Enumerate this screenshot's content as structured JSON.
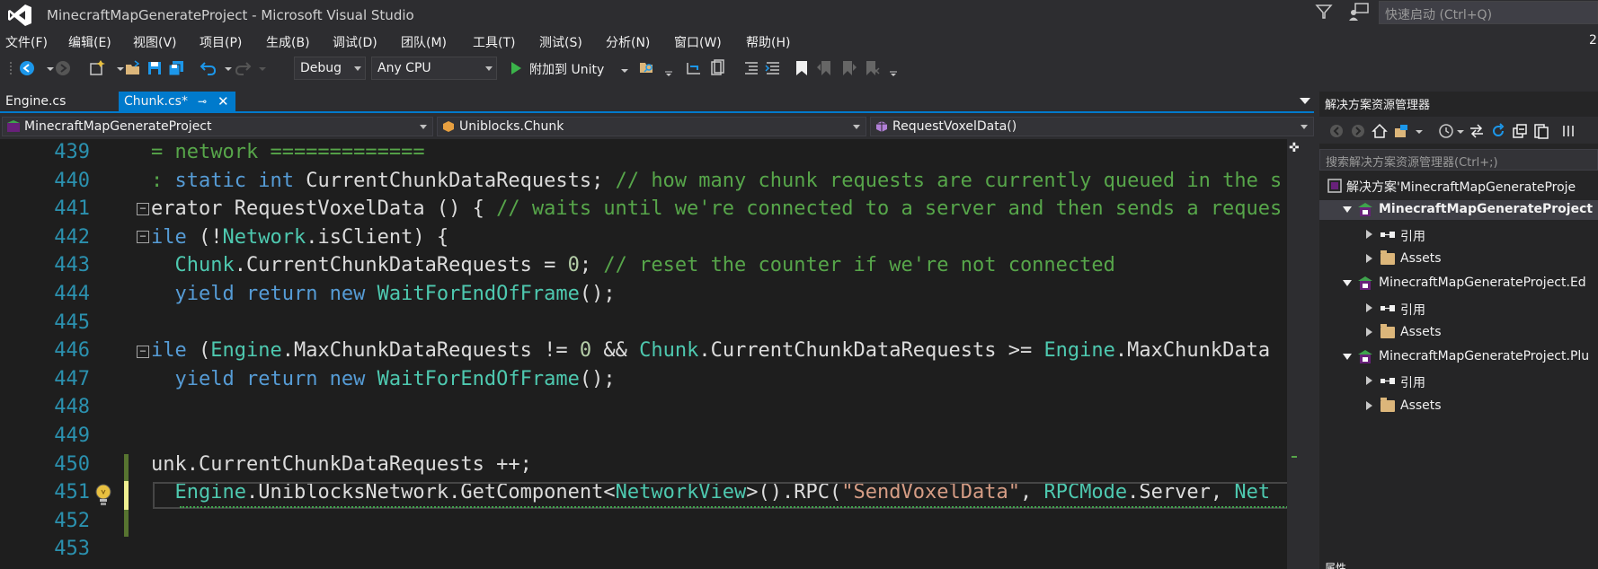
{
  "window": {
    "title": "MinecraftMapGenerateProject - Microsoft Visual Studio",
    "quick_launch_placeholder": "快速启动 (Ctrl+Q)",
    "right_edge_text": "2"
  },
  "menu": [
    "文件(F)",
    "编辑(E)",
    "视图(V)",
    "项目(P)",
    "生成(B)",
    "调试(D)",
    "团队(M)",
    "工具(T)",
    "测试(S)",
    "分析(N)",
    "窗口(W)",
    "帮助(H)"
  ],
  "toolbar": {
    "configuration": "Debug",
    "platform": "Any CPU",
    "start_label": "附加到 Unity"
  },
  "tabs": [
    {
      "label": "Engine.cs",
      "active": false
    },
    {
      "label": "Chunk.cs*",
      "active": true
    }
  ],
  "navbar": {
    "project": "MinecraftMapGenerateProject",
    "type": "Uniblocks.Chunk",
    "member": "RequestVoxelData()"
  },
  "editor": {
    "line_numbers": [
      "439",
      "440",
      "441",
      "442",
      "443",
      "444",
      "445",
      "446",
      "447",
      "448",
      "449",
      "450",
      "451",
      "452",
      "453"
    ],
    "code_lines": [
      [
        [
          "cm",
          "= network ============="
        ]
      ],
      [
        [
          "cm",
          ": "
        ],
        [
          "kw",
          "static int "
        ],
        [
          "",
          "CurrentChunkDataRequests; "
        ],
        [
          "cm",
          "// how many chunk requests are currently queued in the s"
        ]
      ],
      [
        [
          "",
          "erator RequestVoxelData () { "
        ],
        [
          "cm",
          "// waits until we're connected to a server and then sends a reques"
        ]
      ],
      [
        [
          "kw",
          "ile "
        ],
        [
          "",
          "(!"
        ],
        [
          "ty",
          "Network"
        ],
        [
          "",
          ".isClient) {"
        ]
      ],
      [
        [
          "",
          "  "
        ],
        [
          "ty",
          "Chunk"
        ],
        [
          "",
          ".CurrentChunkDataRequests = "
        ],
        [
          "nm",
          "0"
        ],
        [
          "",
          "; "
        ],
        [
          "cm",
          "// reset the counter if we're not connected"
        ]
      ],
      [
        [
          "",
          "  "
        ],
        [
          "kw",
          "yield return new "
        ],
        [
          "ty",
          "WaitForEndOfFrame"
        ],
        [
          "",
          "();"
        ]
      ],
      [
        [
          "",
          ""
        ]
      ],
      [
        [
          "kw",
          "ile "
        ],
        [
          "",
          "("
        ],
        [
          "ty",
          "Engine"
        ],
        [
          "",
          ".MaxChunkDataRequests != "
        ],
        [
          "nm",
          "0"
        ],
        [
          "",
          " && "
        ],
        [
          "ty",
          "Chunk"
        ],
        [
          "",
          ".CurrentChunkDataRequests >= "
        ],
        [
          "ty",
          "Engine"
        ],
        [
          "",
          ".MaxChunkData"
        ]
      ],
      [
        [
          "",
          "  "
        ],
        [
          "kw",
          "yield return new "
        ],
        [
          "ty",
          "WaitForEndOfFrame"
        ],
        [
          "",
          "();"
        ]
      ],
      [
        [
          "",
          ""
        ]
      ],
      [
        [
          "",
          ""
        ]
      ],
      [
        [
          "",
          "unk.CurrentChunkDataRequests ++;"
        ]
      ],
      [
        [
          "",
          "  "
        ],
        [
          "ty",
          "Engine"
        ],
        [
          "",
          ".UniblocksNetwork.GetComponent<"
        ],
        [
          "ty",
          "NetworkView"
        ],
        [
          "",
          ">().RPC("
        ],
        [
          "st",
          "\"SendVoxelData\""
        ],
        [
          "",
          ", "
        ],
        [
          "ty",
          "RPCMode"
        ],
        [
          "",
          ".Server, "
        ],
        [
          "ty",
          "Net"
        ]
      ],
      [
        [
          "",
          ""
        ]
      ],
      [
        [
          "",
          ""
        ]
      ]
    ]
  },
  "solution_explorer": {
    "title": "解决方案资源管理器",
    "search_placeholder": "搜索解决方案资源管理器(Ctrl+;)",
    "tree": [
      {
        "label": "解决方案'MinecraftMapGenerateProje",
        "kind": "solution",
        "indent": 0
      },
      {
        "label": "MinecraftMapGenerateProject",
        "kind": "project",
        "indent": 1,
        "bold": true,
        "selected": true
      },
      {
        "label": "引用",
        "kind": "references",
        "indent": 2
      },
      {
        "label": "Assets",
        "kind": "folder",
        "indent": 2
      },
      {
        "label": "MinecraftMapGenerateProject.Ed",
        "kind": "project",
        "indent": 1
      },
      {
        "label": "引用",
        "kind": "references",
        "indent": 2
      },
      {
        "label": "Assets",
        "kind": "folder",
        "indent": 2
      },
      {
        "label": "MinecraftMapGenerateProject.Plu",
        "kind": "project",
        "indent": 1
      },
      {
        "label": "引用",
        "kind": "references",
        "indent": 2
      },
      {
        "label": "Assets",
        "kind": "folder",
        "indent": 2
      }
    ],
    "properties_label": "属性"
  }
}
